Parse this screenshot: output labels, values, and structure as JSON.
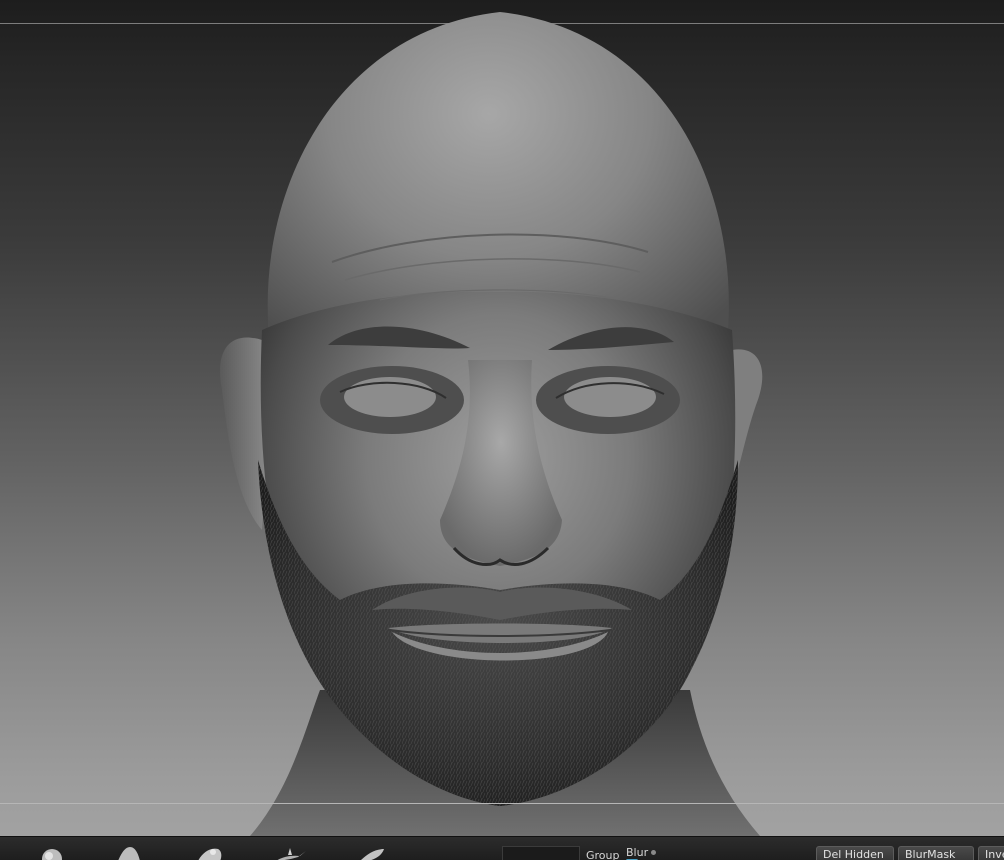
{
  "tray": {
    "group_label": "Group",
    "blur_label": "Blur",
    "del_hidden_label": "Del Hidden",
    "blurmask_label": "BlurMask",
    "inverse_label": "Inve"
  },
  "brushes": [
    {
      "icon": "clay-brush-icon"
    },
    {
      "icon": "standard-brush-icon"
    },
    {
      "icon": "move-brush-icon"
    },
    {
      "icon": "spike-brush-icon"
    },
    {
      "icon": "pinch-brush-icon"
    }
  ],
  "colors": {
    "accent": "#4aa3c8",
    "tray_background": "#262626",
    "viewport_top": "#1d1d1d",
    "viewport_bottom": "#a2a2a2"
  }
}
